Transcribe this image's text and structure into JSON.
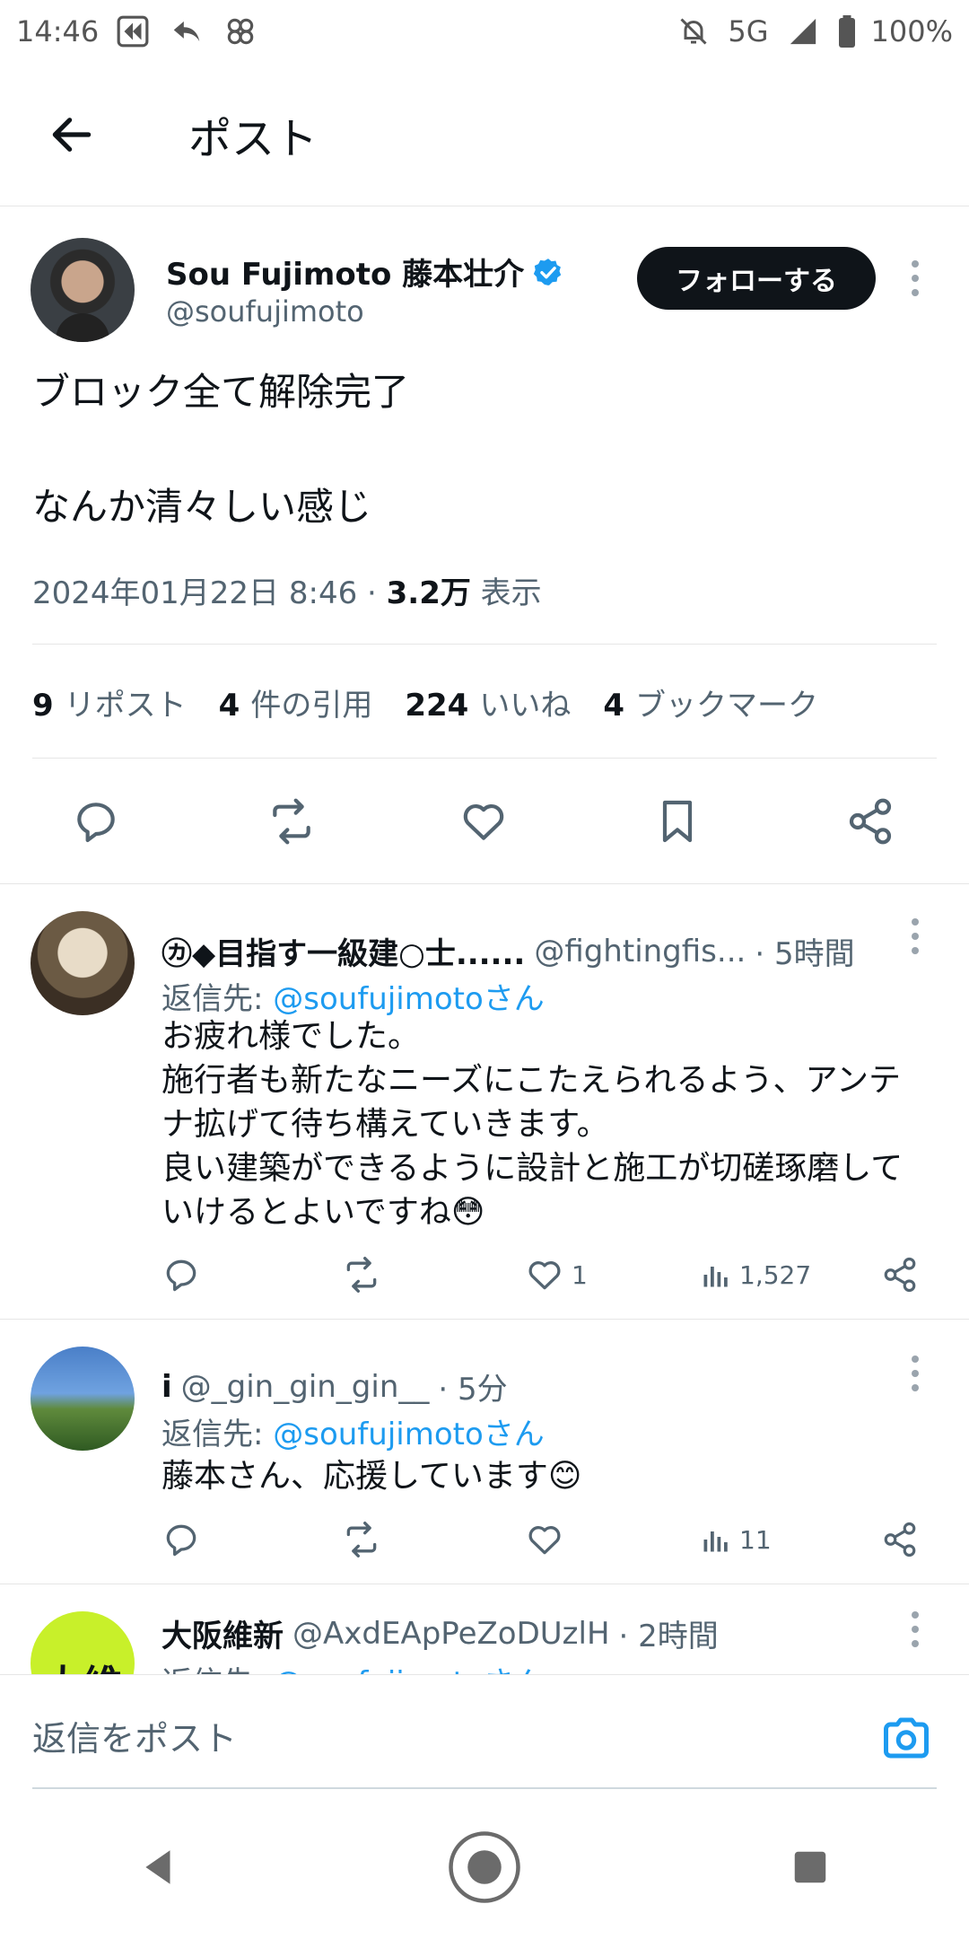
{
  "status_bar": {
    "time": "14:46",
    "network": "5G",
    "battery": "100%"
  },
  "header": {
    "title": "ポスト"
  },
  "post": {
    "author_name": "Sou Fujimoto 藤本壮介",
    "author_handle": "@soufujimoto",
    "follow_label": "フォローする",
    "text": "ブロック全て解除完了\n\nなんか清々しい感じ",
    "date": "2024年01月22日 8:46 · ",
    "views_count": "3.2万",
    "views_label": " 表示",
    "stats": {
      "reposts_count": "9",
      "reposts_label": "リポスト",
      "quotes_count": "4",
      "quotes_label": "件の引用",
      "likes_count": "224",
      "likes_label": "いいね",
      "bookmarks_count": "4",
      "bookmarks_label": "ブックマーク"
    }
  },
  "replies": [
    {
      "name": "㋕◆目指す一級建○士......",
      "handle": "@fightingfis...",
      "time": "· 5時間",
      "reply_to_prefix": "返信先: ",
      "reply_to": "@soufujimotoさん",
      "text": "お疲れ様でした。\n施行者も新たなニーズにこたえられるよう、アンテナ拡げて待ち構えていきます。\n良い建築ができるように設計と施工が切磋琢磨していけるとよいですね😳",
      "likes": "1",
      "views": "1,527"
    },
    {
      "name": "i",
      "handle": "@_gin_gin_gin__",
      "time": "· 5分",
      "reply_to_prefix": "返信先: ",
      "reply_to": "@soufujimotoさん",
      "text": "藤本さん、応援しています😊",
      "likes": "",
      "views": "11"
    },
    {
      "name": "大阪維新",
      "handle": "@AxdEApPeZoDUzlH",
      "time": "· 2時間",
      "reply_to_prefix": "返信先: ",
      "reply_to": "@soufujimotoさん",
      "avatar_text": "大維"
    }
  ],
  "composer": {
    "placeholder": "返信をポスト"
  },
  "colors": {
    "accent": "#1d9bf0",
    "text": "#0f1419",
    "secondary": "#536471"
  }
}
